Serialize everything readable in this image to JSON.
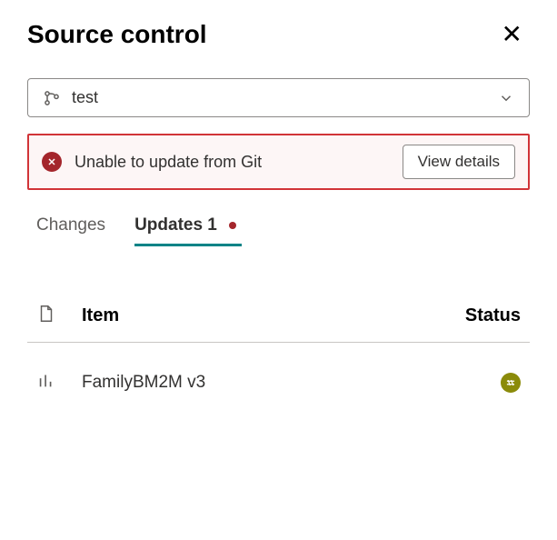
{
  "header": {
    "title": "Source control"
  },
  "branch": {
    "name": "test"
  },
  "error": {
    "message": "Unable to update from Git",
    "action_label": "View details"
  },
  "tabs": {
    "changes": "Changes",
    "updates": "Updates 1"
  },
  "table": {
    "headers": {
      "item": "Item",
      "status": "Status"
    },
    "rows": [
      {
        "name": "FamilyBM2M v3"
      }
    ]
  }
}
